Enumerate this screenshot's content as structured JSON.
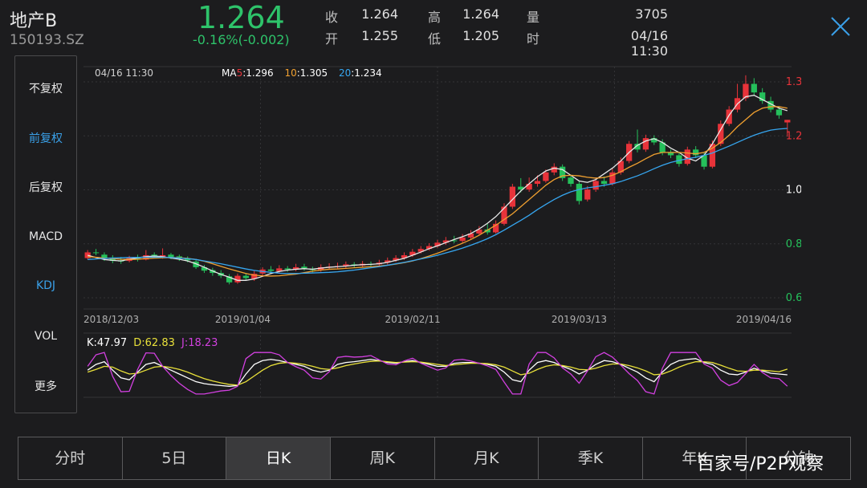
{
  "header": {
    "name": "地产B",
    "code": "150193.SZ",
    "price": "1.264",
    "change": "-0.16%(-0.002)",
    "quote": [
      {
        "label": "收",
        "value": "1.264"
      },
      {
        "label": "开",
        "value": "1.255"
      },
      {
        "label": "高",
        "value": "1.264"
      },
      {
        "label": "低",
        "value": "1.205"
      },
      {
        "label": "量",
        "value": "3705"
      },
      {
        "label": "时",
        "value": "04/16 11:30"
      }
    ],
    "close_icon": "close-icon"
  },
  "sidebar": {
    "items": [
      {
        "label": "不复权",
        "active": false
      },
      {
        "label": "前复权",
        "active": true
      },
      {
        "label": "后复权",
        "active": false
      },
      {
        "label": "MACD",
        "active": false
      },
      {
        "label": "KDJ",
        "active": true
      },
      {
        "label": "VOL",
        "active": false
      },
      {
        "label": "更多",
        "active": false
      }
    ]
  },
  "chart_info": {
    "date": "04/16 11:30",
    "ma_prefix": "MA",
    "ma5_label": "5",
    "ma5_value": ":1.296",
    "ma10_label": "10",
    "ma10_value": ":1.305",
    "ma20_label": "20",
    "ma20_value": ":1.234",
    "kdj_k": "K:47.97",
    "kdj_d": "D:62.83",
    "kdj_j": "J:18.23"
  },
  "colors": {
    "up": "#e8333a",
    "down": "#25c05b",
    "ma5": "#e8e8e8",
    "ma5_label": "#e8333a",
    "ma10": "#f0a030",
    "ma20": "#36a6f0",
    "k": "#ffffff",
    "d": "#e9e13a",
    "j": "#d240e0"
  },
  "tabs": [
    {
      "label": "分时",
      "active": false
    },
    {
      "label": "5日",
      "active": false
    },
    {
      "label": "日K",
      "active": true
    },
    {
      "label": "周K",
      "active": false
    },
    {
      "label": "月K",
      "active": false
    },
    {
      "label": "季K",
      "active": false
    },
    {
      "label": "年K",
      "active": false
    },
    {
      "label": "分钟",
      "active": false
    }
  ],
  "watermark": "百家号/P2P观察",
  "chart_data": [
    {
      "type": "candlestick",
      "y_ticks": [
        "1.397",
        "1.208",
        "1.019",
        "0.830",
        "0.641"
      ],
      "ylim": [
        0.641,
        1.397
      ],
      "x_ticks": [
        "2018/12/03",
        "2019/01/04",
        "2019/02/11",
        "2019/03/13",
        "2019/04/16"
      ],
      "grid": true,
      "series": [
        {
          "name": "MA5",
          "values": [
            0.79,
            0.782,
            0.775,
            0.772,
            0.77,
            0.776,
            0.781,
            0.785,
            0.787,
            0.785,
            0.78,
            0.776,
            0.77,
            0.76,
            0.748,
            0.735,
            0.723,
            0.713,
            0.702,
            0.702,
            0.707,
            0.716,
            0.726,
            0.733,
            0.738,
            0.741,
            0.743,
            0.741,
            0.745,
            0.748,
            0.75,
            0.752,
            0.755,
            0.757,
            0.758,
            0.76,
            0.765,
            0.772,
            0.779,
            0.79,
            0.801,
            0.813,
            0.823,
            0.834,
            0.845,
            0.855,
            0.866,
            0.882,
            0.902,
            0.925,
            0.955,
            0.985,
            1.015,
            1.04,
            1.065,
            1.085,
            1.095,
            1.09,
            1.07,
            1.05,
            1.045,
            1.055,
            1.075,
            1.095,
            1.12,
            1.15,
            1.175,
            1.19,
            1.198,
            1.185,
            1.165,
            1.15,
            1.13,
            1.12,
            1.14,
            1.18,
            1.23,
            1.28,
            1.32,
            1.345,
            1.35,
            1.335,
            1.32,
            1.305,
            1.296
          ]
        },
        {
          "name": "MA10",
          "values": [
            0.785,
            0.783,
            0.78,
            0.778,
            0.776,
            0.775,
            0.776,
            0.778,
            0.78,
            0.781,
            0.782,
            0.781,
            0.779,
            0.775,
            0.769,
            0.76,
            0.751,
            0.742,
            0.734,
            0.726,
            0.72,
            0.718,
            0.717,
            0.718,
            0.721,
            0.724,
            0.729,
            0.734,
            0.738,
            0.741,
            0.742,
            0.744,
            0.746,
            0.748,
            0.75,
            0.752,
            0.755,
            0.759,
            0.764,
            0.77,
            0.778,
            0.787,
            0.797,
            0.808,
            0.82,
            0.832,
            0.845,
            0.86,
            0.878,
            0.895,
            0.915,
            0.935,
            0.96,
            0.985,
            1.01,
            1.035,
            1.055,
            1.068,
            1.07,
            1.068,
            1.063,
            1.06,
            1.062,
            1.07,
            1.082,
            1.098,
            1.112,
            1.128,
            1.143,
            1.15,
            1.15,
            1.15,
            1.148,
            1.145,
            1.15,
            1.165,
            1.185,
            1.21,
            1.24,
            1.265,
            1.29,
            1.305,
            1.31,
            1.31,
            1.305
          ]
        },
        {
          "name": "MA20",
          "values": [
            0.775,
            0.777,
            0.779,
            0.78,
            0.781,
            0.782,
            0.782,
            0.783,
            0.783,
            0.783,
            0.782,
            0.78,
            0.778,
            0.775,
            0.77,
            0.765,
            0.76,
            0.754,
            0.748,
            0.742,
            0.737,
            0.733,
            0.73,
            0.727,
            0.726,
            0.726,
            0.727,
            0.728,
            0.729,
            0.73,
            0.732,
            0.735,
            0.738,
            0.742,
            0.746,
            0.75,
            0.755,
            0.76,
            0.765,
            0.771,
            0.777,
            0.783,
            0.79,
            0.798,
            0.806,
            0.815,
            0.825,
            0.836,
            0.848,
            0.862,
            0.878,
            0.895,
            0.912,
            0.93,
            0.95,
            0.968,
            0.985,
            1.0,
            1.012,
            1.02,
            1.026,
            1.03,
            1.035,
            1.04,
            1.048,
            1.058,
            1.068,
            1.08,
            1.093,
            1.105,
            1.115,
            1.122,
            1.128,
            1.133,
            1.14,
            1.148,
            1.16,
            1.172,
            1.185,
            1.198,
            1.21,
            1.22,
            1.228,
            1.232,
            1.234
          ]
        }
      ],
      "candles": [
        [
          0.78,
          0.8,
          0.808,
          0.775
        ],
        [
          0.8,
          0.798,
          0.812,
          0.79
        ],
        [
          0.792,
          0.78,
          0.8,
          0.77
        ],
        [
          0.782,
          0.77,
          0.79,
          0.762
        ],
        [
          0.772,
          0.768,
          0.784,
          0.76
        ],
        [
          0.77,
          0.782,
          0.788,
          0.765
        ],
        [
          0.78,
          0.775,
          0.792,
          0.768
        ],
        [
          0.775,
          0.79,
          0.808,
          0.772
        ],
        [
          0.792,
          0.786,
          0.8,
          0.78
        ],
        [
          0.785,
          0.79,
          0.814,
          0.778
        ],
        [
          0.792,
          0.784,
          0.798,
          0.776
        ],
        [
          0.786,
          0.778,
          0.792,
          0.77
        ],
        [
          0.778,
          0.772,
          0.786,
          0.765
        ],
        [
          0.768,
          0.748,
          0.774,
          0.742
        ],
        [
          0.748,
          0.736,
          0.756,
          0.728
        ],
        [
          0.738,
          0.728,
          0.746,
          0.718
        ],
        [
          0.728,
          0.718,
          0.738,
          0.71
        ],
        [
          0.716,
          0.695,
          0.724,
          0.688
        ],
        [
          0.695,
          0.718,
          0.726,
          0.69
        ],
        [
          0.718,
          0.71,
          0.728,
          0.702
        ],
        [
          0.708,
          0.725,
          0.735,
          0.7
        ],
        [
          0.726,
          0.74,
          0.748,
          0.718
        ],
        [
          0.74,
          0.735,
          0.752,
          0.726
        ],
        [
          0.734,
          0.744,
          0.755,
          0.728
        ],
        [
          0.744,
          0.74,
          0.752,
          0.732
        ],
        [
          0.74,
          0.748,
          0.76,
          0.734
        ],
        [
          0.75,
          0.744,
          0.76,
          0.736
        ],
        [
          0.742,
          0.738,
          0.75,
          0.73
        ],
        [
          0.738,
          0.748,
          0.758,
          0.732
        ],
        [
          0.748,
          0.75,
          0.762,
          0.74
        ],
        [
          0.75,
          0.752,
          0.764,
          0.742
        ],
        [
          0.752,
          0.758,
          0.768,
          0.745
        ],
        [
          0.758,
          0.754,
          0.766,
          0.746
        ],
        [
          0.754,
          0.76,
          0.77,
          0.748
        ],
        [
          0.76,
          0.758,
          0.768,
          0.75
        ],
        [
          0.758,
          0.764,
          0.774,
          0.752
        ],
        [
          0.764,
          0.772,
          0.782,
          0.758
        ],
        [
          0.772,
          0.78,
          0.79,
          0.766
        ],
        [
          0.78,
          0.79,
          0.8,
          0.774
        ],
        [
          0.79,
          0.802,
          0.812,
          0.784
        ],
        [
          0.802,
          0.812,
          0.822,
          0.796
        ],
        [
          0.812,
          0.822,
          0.832,
          0.806
        ],
        [
          0.822,
          0.834,
          0.844,
          0.816
        ],
        [
          0.834,
          0.842,
          0.854,
          0.826
        ],
        [
          0.842,
          0.84,
          0.858,
          0.832
        ],
        [
          0.84,
          0.852,
          0.864,
          0.834
        ],
        [
          0.852,
          0.866,
          0.878,
          0.846
        ],
        [
          0.866,
          0.88,
          0.892,
          0.86
        ],
        [
          0.88,
          0.87,
          0.9,
          0.862
        ],
        [
          0.87,
          0.9,
          0.912,
          0.866
        ],
        [
          0.9,
          0.96,
          0.972,
          0.894
        ],
        [
          0.96,
          1.03,
          1.04,
          0.952
        ],
        [
          1.03,
          1.02,
          1.06,
          1.01
        ],
        [
          1.02,
          1.04,
          1.062,
          1.012
        ],
        [
          1.04,
          1.05,
          1.07,
          1.03
        ],
        [
          1.05,
          1.08,
          1.09,
          1.044
        ],
        [
          1.08,
          1.1,
          1.112,
          1.07
        ],
        [
          1.1,
          1.06,
          1.108,
          1.05
        ],
        [
          1.062,
          1.04,
          1.072,
          1.03
        ],
        [
          1.04,
          0.98,
          1.048,
          0.968
        ],
        [
          0.985,
          1.02,
          1.032,
          0.978
        ],
        [
          1.02,
          1.05,
          1.062,
          1.012
        ],
        [
          1.05,
          1.04,
          1.066,
          1.03
        ],
        [
          1.04,
          1.08,
          1.094,
          1.034
        ],
        [
          1.08,
          1.12,
          1.132,
          1.072
        ],
        [
          1.12,
          1.18,
          1.19,
          1.112
        ],
        [
          1.18,
          1.16,
          1.23,
          1.15
        ],
        [
          1.16,
          1.2,
          1.212,
          1.152
        ],
        [
          1.2,
          1.185,
          1.21,
          1.176
        ],
        [
          1.185,
          1.15,
          1.196,
          1.14
        ],
        [
          1.15,
          1.14,
          1.16,
          1.13
        ],
        [
          1.14,
          1.11,
          1.15,
          1.1
        ],
        [
          1.11,
          1.16,
          1.17,
          1.104
        ],
        [
          1.16,
          1.14,
          1.172,
          1.13
        ],
        [
          1.14,
          1.1,
          1.15,
          1.09
        ],
        [
          1.1,
          1.18,
          1.192,
          1.094
        ],
        [
          1.18,
          1.25,
          1.262,
          1.172
        ],
        [
          1.25,
          1.3,
          1.312,
          1.242
        ],
        [
          1.3,
          1.34,
          1.39,
          1.29
        ],
        [
          1.34,
          1.39,
          1.42,
          1.33
        ],
        [
          1.39,
          1.36,
          1.41,
          1.35
        ],
        [
          1.36,
          1.33,
          1.375,
          1.32
        ],
        [
          1.33,
          1.3,
          1.345,
          1.29
        ],
        [
          1.3,
          1.28,
          1.312,
          1.268
        ],
        [
          1.255,
          1.264,
          1.264,
          1.205
        ]
      ]
    },
    {
      "type": "line",
      "title": "KDJ",
      "y_ticks": [
        "106.35",
        "-2.22"
      ],
      "ylim": [
        -2.22,
        106.35
      ],
      "series": [
        {
          "name": "K",
          "values": [
            60,
            75,
            82,
            60,
            40,
            35,
            55,
            75,
            80,
            70,
            60,
            50,
            40,
            30,
            25,
            22,
            20,
            18,
            20,
            50,
            75,
            85,
            88,
            85,
            80,
            75,
            70,
            60,
            55,
            60,
            75,
            80,
            82,
            85,
            88,
            85,
            80,
            78,
            82,
            85,
            80,
            75,
            70,
            70,
            78,
            80,
            80,
            78,
            75,
            70,
            55,
            35,
            30,
            60,
            80,
            85,
            80,
            70,
            62,
            50,
            60,
            75,
            85,
            82,
            75,
            65,
            55,
            40,
            30,
            55,
            75,
            85,
            88,
            90,
            80,
            75,
            60,
            50,
            48,
            55,
            65,
            58,
            52,
            50,
            47.97
          ]
        },
        {
          "name": "D",
          "values": [
            55,
            62,
            70,
            68,
            58,
            50,
            52,
            60,
            68,
            70,
            67,
            62,
            55,
            46,
            38,
            32,
            27,
            23,
            21,
            30,
            45,
            60,
            72,
            78,
            80,
            78,
            75,
            70,
            64,
            62,
            66,
            72,
            76,
            80,
            83,
            84,
            82,
            80,
            81,
            82,
            81,
            78,
            75,
            72,
            74,
            76,
            78,
            78,
            77,
            74,
            68,
            58,
            48,
            52,
            62,
            70,
            74,
            72,
            68,
            62,
            61,
            65,
            72,
            76,
            76,
            72,
            66,
            58,
            48,
            50,
            58,
            68,
            76,
            82,
            82,
            80,
            73,
            65,
            58,
            57,
            60,
            60,
            58,
            56,
            62.83
          ]
        },
        {
          "name": "J",
          "values": [
            70,
            100,
            106,
            44,
            4,
            5,
            62,
            105,
            104,
            70,
            46,
            26,
            10,
            -2,
            -2,
            2,
            6,
            8,
            18,
            90,
            106,
            106,
            106,
            100,
            80,
            69,
            60,
            40,
            37,
            56,
            93,
            96,
            94,
            95,
            98,
            87,
            76,
            74,
            84,
            91,
            78,
            69,
            60,
            66,
            86,
            88,
            84,
            78,
            71,
            62,
            29,
            -2,
            -2,
            76,
            106,
            106,
            92,
            66,
            50,
            26,
            58,
            95,
            106,
            94,
            73,
            51,
            33,
            4,
            -2,
            65,
            106,
            106,
            106,
            106,
            76,
            65,
            34,
            20,
            28,
            51,
            75,
            54,
            40,
            38,
            18.23
          ]
        }
      ]
    }
  ]
}
